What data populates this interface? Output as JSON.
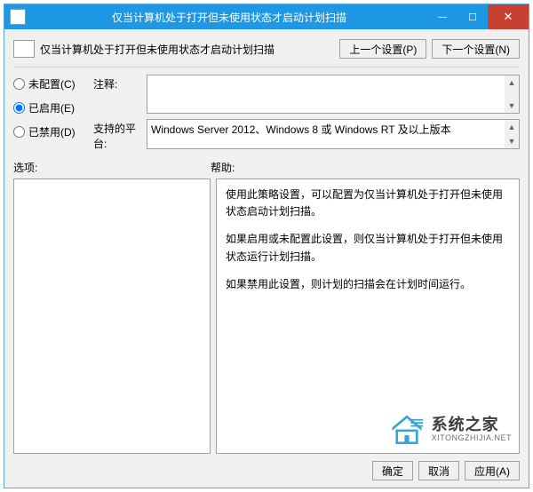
{
  "titlebar": {
    "title": "仅当计算机处于打开但未使用状态才启动计划扫描"
  },
  "header": {
    "policy_title": "仅当计算机处于打开但未使用状态才启动计划扫描",
    "prev_btn": "上一个设置(P)",
    "next_btn": "下一个设置(N)"
  },
  "radios": {
    "not_configured": "未配置(C)",
    "enabled": "已启用(E)",
    "disabled": "已禁用(D)",
    "selected": "enabled"
  },
  "labels": {
    "comment": "注释:",
    "supported": "支持的平台:",
    "options": "选项:",
    "help": "帮助:"
  },
  "comment_text": "",
  "supported_text": "Windows Server 2012、Windows 8 或 Windows RT 及以上版本",
  "help_paragraphs": [
    "使用此策略设置，可以配置为仅当计算机处于打开但未使用状态启动计划扫描。",
    "如果启用或未配置此设置，则仅当计算机处于打开但未使用状态运行计划扫描。",
    "如果禁用此设置，则计划的扫描会在计划时间运行。"
  ],
  "footer": {
    "ok": "确定",
    "cancel": "取消",
    "apply": "应用(A)"
  },
  "watermark": {
    "cn": "系统之家",
    "en": "XITONGZHIJIA.NET"
  }
}
